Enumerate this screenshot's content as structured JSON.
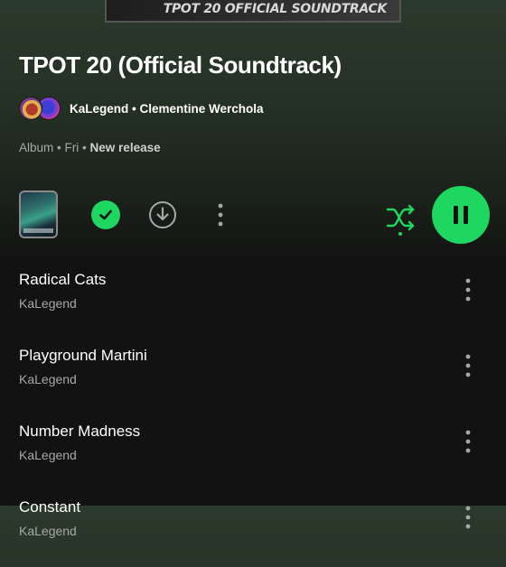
{
  "header": {
    "cover_caption": "TPOT 20 OFFICIAL SOUNDTRACK",
    "album_title": "TPOT 20 (Official Soundtrack)",
    "artists": "KaLegend • Clementine Werchola",
    "meta": {
      "type": "Album",
      "separator": "•",
      "date": "Fri",
      "status": "New release"
    }
  },
  "controls": {
    "saved": "check-icon",
    "download": "download-icon",
    "more": "more-vertical-icon",
    "shuffle": "shuffle-icon",
    "play_state": "pause-icon"
  },
  "colors": {
    "accent": "#1ed760",
    "background": "#121212",
    "secondary_text": "#a7a7a7"
  },
  "tracks": [
    {
      "title": "Radical Cats",
      "artist": "KaLegend"
    },
    {
      "title": "Playground Martini",
      "artist": "KaLegend"
    },
    {
      "title": "Number Madness",
      "artist": "KaLegend"
    },
    {
      "title": "Constant",
      "artist": "KaLegend"
    }
  ]
}
